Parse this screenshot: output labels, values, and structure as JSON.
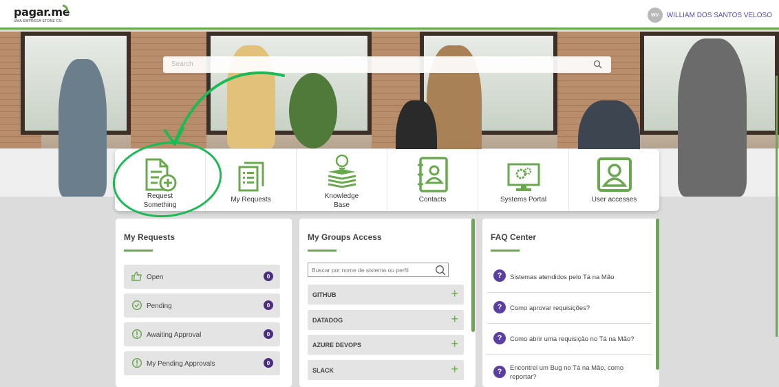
{
  "header": {
    "logo_text": "pagar.me",
    "logo_tagline": "UMA EMPRESA STONE CO.",
    "user_initials": "WV",
    "user_name": "WILLIAM DOS SANTOS VELOSO"
  },
  "search": {
    "placeholder": "Search"
  },
  "tiles": [
    {
      "line1": "Request",
      "line2": "Something",
      "icon": "request-add-icon"
    },
    {
      "line1": "My Requests",
      "icon": "document-list-icon"
    },
    {
      "line1": "Knowledge",
      "line2": "Base",
      "icon": "books-lightbulb-icon"
    },
    {
      "line1": "Contacts",
      "icon": "address-book-icon"
    },
    {
      "line1": "Systems Portal",
      "icon": "monitor-gears-icon"
    },
    {
      "line1": "User accesses",
      "icon": "user-badge-icon"
    }
  ],
  "my_requests": {
    "title": "My Requests",
    "items": [
      {
        "label": "Open",
        "count": "0",
        "icon": "thumbs-up-icon"
      },
      {
        "label": "Pending",
        "count": "0",
        "icon": "check-circle-icon"
      },
      {
        "label": "Awaiting Approval",
        "count": "0",
        "icon": "alert-circle-icon"
      },
      {
        "label": "My Pending Approvals",
        "count": "0",
        "icon": "alert-circle-icon"
      }
    ]
  },
  "groups": {
    "title": "My Groups Access",
    "search_placeholder": "Buscar por nome de sistema ou perfil",
    "items": [
      "GITHUB",
      "DATADOG",
      "AZURE DEVOPS",
      "SLACK"
    ]
  },
  "faq": {
    "title": "FAQ Center",
    "items": [
      "Sistemas atendidos pelo Tá na Mão",
      "Como aprovar requisições?",
      "Como abrir uma requisição no Tá na Mão?",
      "Encontrei um Bug no Tá na Mão, como reportar?"
    ]
  },
  "colors": {
    "accent_green": "#6aa84f",
    "brand_purple": "#4b2d83",
    "annotation_green": "#1db954"
  }
}
